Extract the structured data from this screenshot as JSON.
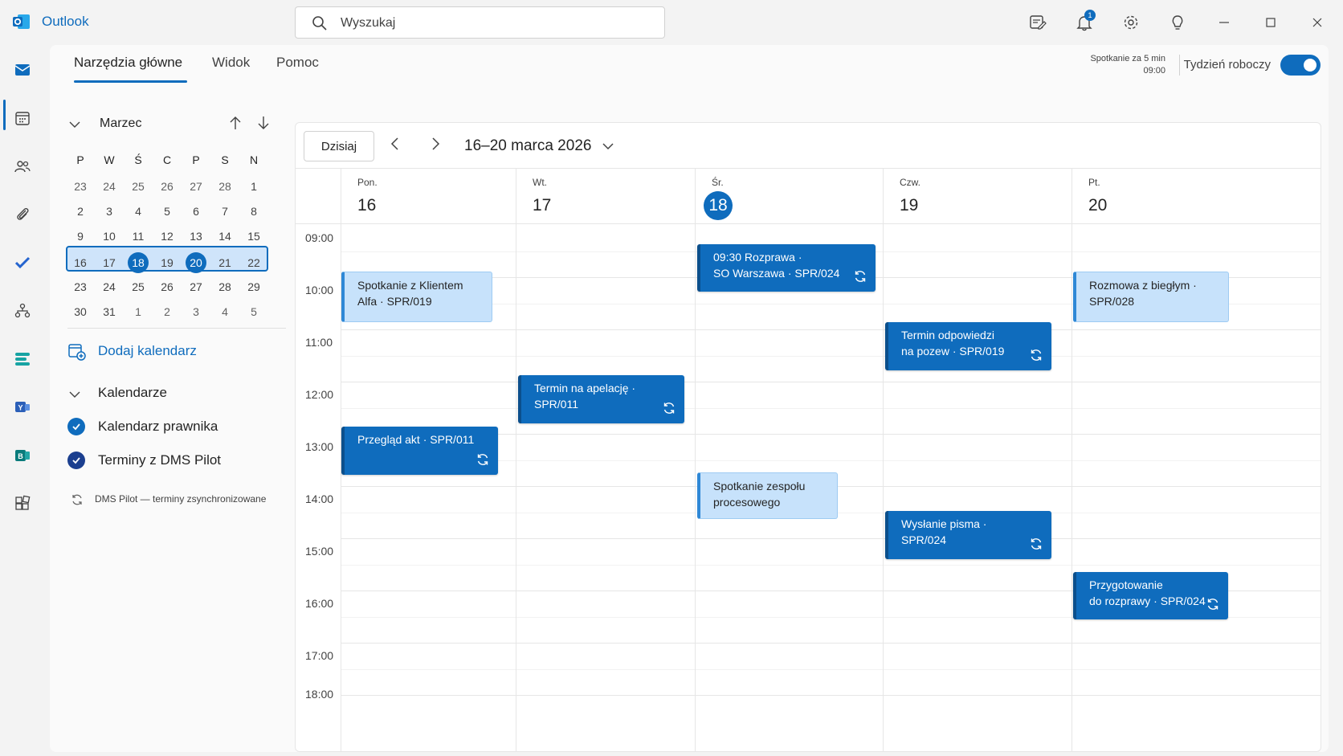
{
  "app": {
    "title": "Outlook"
  },
  "search": {
    "placeholder": "Wyszukaj"
  },
  "titlebar": {
    "notifications_count": "1"
  },
  "ribbon": {
    "tabs": [
      {
        "label": "Narzędzia główne"
      },
      {
        "label": "Widok"
      },
      {
        "label": "Pomoc"
      }
    ]
  },
  "reminder": {
    "line1": "Spotkanie za 5 min",
    "line2": "09:00"
  },
  "workweek": {
    "label": "Tydzień roboczy",
    "enabled": true
  },
  "mini_calendar": {
    "month": "Marzec",
    "weekdays": [
      "P",
      "W",
      "Ś",
      "C",
      "P",
      "S",
      "N"
    ],
    "weeks": [
      [
        "23",
        "24",
        "25",
        "26",
        "27",
        "28",
        "1"
      ],
      [
        "2",
        "3",
        "4",
        "5",
        "6",
        "7",
        "8"
      ],
      [
        "9",
        "10",
        "11",
        "12",
        "13",
        "14",
        "15"
      ],
      [
        "16",
        "17",
        "18",
        "19",
        "20",
        "21",
        "22"
      ],
      [
        "23",
        "24",
        "25",
        "26",
        "27",
        "28",
        "29"
      ],
      [
        "30",
        "31",
        "1",
        "2",
        "3",
        "4",
        "5"
      ]
    ]
  },
  "sidebar": {
    "add_calendar": "Dodaj kalendarz",
    "calendars_title": "Kalendarze",
    "calendars": [
      {
        "label": "Kalendarz prawnika",
        "color": "#0f6cbd"
      },
      {
        "label": "Terminy z DMS Pilot",
        "color": "#1b3f8f"
      }
    ],
    "sync_note": "DMS Pilot — terminy zsynchronizowane"
  },
  "calendar": {
    "today_button": "Dzisiaj",
    "range": "16–20 marca 2026",
    "days": [
      {
        "dow": "Pon.",
        "num": "16"
      },
      {
        "dow": "Wt.",
        "num": "17"
      },
      {
        "dow": "Śr.",
        "num": "18"
      },
      {
        "dow": "Czw.",
        "num": "19"
      },
      {
        "dow": "Pt.",
        "num": "20"
      }
    ],
    "hours": [
      "09:00",
      "10:00",
      "11:00",
      "12:00",
      "13:00",
      "14:00",
      "15:00",
      "16:00",
      "17:00",
      "18:00"
    ],
    "events": [
      {
        "text": "Spotkanie z Klientem\nAlfa · SPR/019"
      },
      {
        "text": "Przegląd akt · SPR/011"
      },
      {
        "text": "Termin na apelację ·\nSPR/011"
      },
      {
        "text": "09:30 Rozprawa ·\nSO Warszawa · SPR/024"
      },
      {
        "text": "Spotkanie zespołu\nprocesowego"
      },
      {
        "text": "Termin odpowiedzi\nna pozew · SPR/019"
      },
      {
        "text": "Wysłanie pisma ·\nSPR/024"
      },
      {
        "text": "Rozmowa z biegłym ·\nSPR/028"
      },
      {
        "text": "Przygotowanie\ndo rozprawy · SPR/024"
      }
    ]
  },
  "colors": {
    "accent": "#0f6cbd",
    "event_light": "#c7e2fb"
  }
}
